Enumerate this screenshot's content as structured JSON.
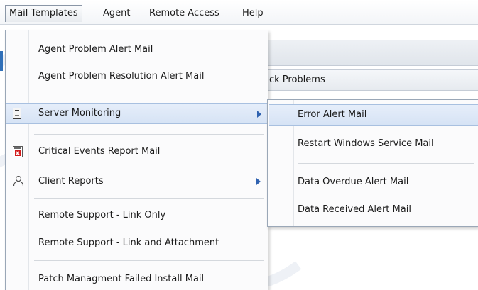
{
  "menubar": {
    "items": [
      {
        "label": "Mail Templates"
      },
      {
        "label": "Agent"
      },
      {
        "label": "Remote Access"
      },
      {
        "label": "Help"
      }
    ]
  },
  "background": {
    "header_text": "ck Problems"
  },
  "mail_templates_menu": {
    "items": [
      {
        "label": "Agent Problem Alert Mail"
      },
      {
        "label": "Agent Problem Resolution Alert Mail"
      },
      {
        "label": "Server Monitoring",
        "icon": "server-icon",
        "has_submenu": true
      },
      {
        "label": "Critical Events Report Mail",
        "icon": "critical-report-icon"
      },
      {
        "label": "Client Reports",
        "icon": "person-icon",
        "has_submenu": true
      },
      {
        "label": "Remote Support - Link Only"
      },
      {
        "label": "Remote Support - Link and Attachment"
      },
      {
        "label": "Patch Managment Failed Install Mail"
      }
    ]
  },
  "server_monitoring_submenu": {
    "items": [
      {
        "label": "Error Alert Mail"
      },
      {
        "label": "Restart Windows Service Mail"
      },
      {
        "label": "Data Overdue Alert Mail"
      },
      {
        "label": "Data Received Alert Mail"
      }
    ]
  },
  "colors": {
    "highlight": "#d6e3f5",
    "menu_border": "#9aa7b7",
    "submenu_arrow": "#2f62b0",
    "critical_red": "#d21b1b"
  }
}
